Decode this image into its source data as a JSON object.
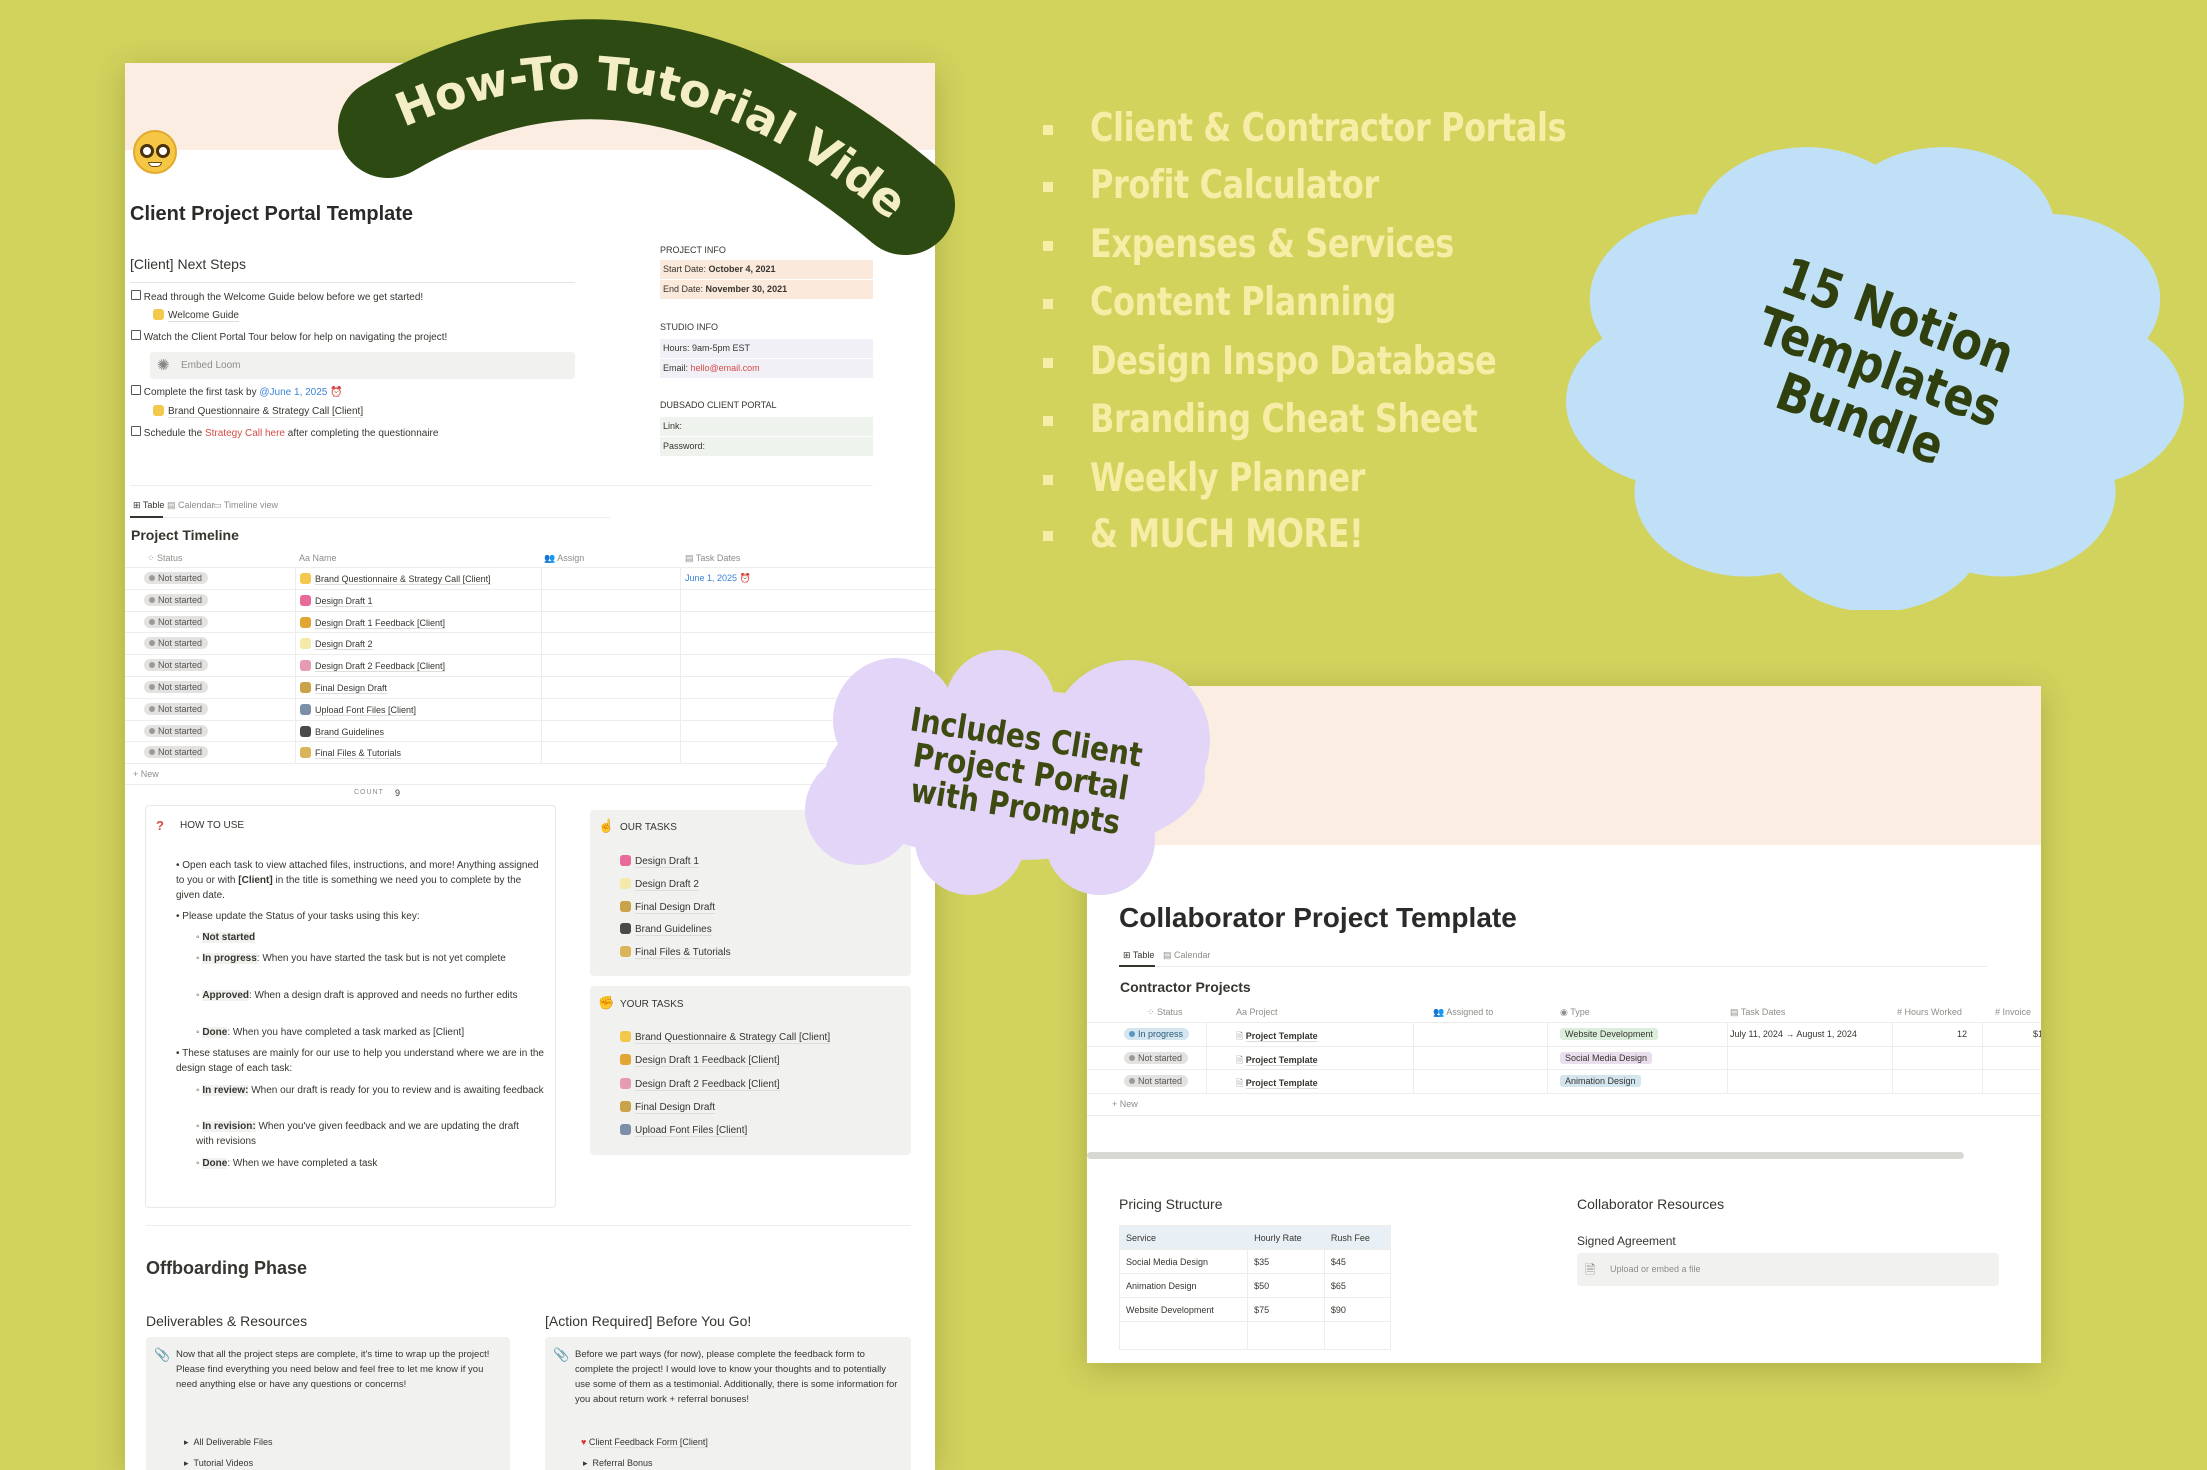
{
  "colors": {
    "background": "#d2d35d",
    "banner": "#2d4a12",
    "feature_text": "#f7eda6",
    "flower": "#bfe0f7",
    "cloud": "#e3d5f7",
    "accent_text": "#3d4a10",
    "peach": "#fbede2"
  },
  "banner": {
    "text": "+ How-To Tutorial Video"
  },
  "features": [
    "Client & Contractor Portals",
    "Profit Calculator",
    "Expenses & Services",
    "Content Planning",
    "Design Inspo Database",
    "Branding Cheat Sheet",
    "Weekly Planner",
    "& MUCH MORE!"
  ],
  "flower": {
    "lines": [
      "15 Notion",
      "Templates",
      "Bundle"
    ]
  },
  "cloud": {
    "lines": [
      "Includes Client",
      "Project Portal",
      "with Prompts"
    ]
  },
  "client_portal": {
    "page_icon": "nerd-face-emoji",
    "title": "Client Project Portal Template",
    "next_steps": {
      "heading": "[Client] Next Steps",
      "item1": "Read through the Welcome Guide below before we get started!",
      "welcome_link": "Welcome Guide",
      "item2": "Watch the Client Portal Tour below for help on navigating the project!",
      "embed": "Embed Loom",
      "item3_prefix": "Complete the first task by ",
      "item3_date": "@June 1, 2025",
      "task_link": "Brand Questionnaire & Strategy Call [Client]",
      "item4_prefix": "Schedule the ",
      "item4_link": "Strategy Call here",
      "item4_suffix": " after completing the questionnaire"
    },
    "project_info": {
      "heading": "PROJECT INFO",
      "start_label": "Start Date: ",
      "start": "October 4, 2021",
      "end_label": "End Date: ",
      "end": "November 30, 2021"
    },
    "studio_info": {
      "heading": "STUDIO INFO",
      "hours": "Hours: 9am-5pm EST",
      "email_label": "Email: ",
      "email": "hello@email.com"
    },
    "dubsado": {
      "heading": "DUBSADO CLIENT PORTAL",
      "link": "Link:",
      "password": "Password:"
    },
    "tabs": [
      "Table",
      "Calendar",
      "Timeline view"
    ],
    "timeline": {
      "title": "Project Timeline",
      "columns": [
        "Status",
        "Name",
        "Assign",
        "Task Dates"
      ],
      "rows": [
        {
          "status": "Not started",
          "name": "Brand Questionnaire & Strategy Call [Client]",
          "date": "June 1, 2025",
          "icon": "#f2c94c"
        },
        {
          "status": "Not started",
          "name": "Design Draft 1",
          "date": "",
          "icon": "#e86a9a"
        },
        {
          "status": "Not started",
          "name": "Design Draft 1 Feedback [Client]",
          "date": "",
          "icon": "#e2a634"
        },
        {
          "status": "Not started",
          "name": "Design Draft 2",
          "date": "",
          "icon": "#f4e9a8"
        },
        {
          "status": "Not started",
          "name": "Design Draft 2 Feedback [Client]",
          "date": "",
          "icon": "#e59bb0"
        },
        {
          "status": "Not started",
          "name": "Final Design Draft",
          "date": "",
          "icon": "#c9a24a"
        },
        {
          "status": "Not started",
          "name": "Upload Font Files [Client]",
          "date": "",
          "icon": "#7b8fa8"
        },
        {
          "status": "Not started",
          "name": "Brand Guidelines",
          "date": "",
          "icon": "#4a4a4a"
        },
        {
          "status": "Not started",
          "name": "Final Files & Tutorials",
          "date": "",
          "icon": "#d9b45a"
        }
      ],
      "new_label": "New",
      "count_label": "COUNT",
      "count": "9"
    },
    "how_to_use": {
      "heading": "HOW TO USE",
      "b1a": "Open each task to view attached files, instructions, and more! Anything assigned to you or with ",
      "b1b": "[Client]",
      "b1c": " in the title is something we need you to complete by the given date.",
      "b2": "Please update the Status of your tasks using this key:",
      "k1": "Not started",
      "k2": "In progress",
      "k2t": ": When you have started the task but is not yet complete",
      "k3": "Approved",
      "k3t": ": When a design draft is approved and needs no further edits",
      "k4": "Done",
      "k4t": ": When you have completed a task marked as [Client]",
      "b3": "These statuses are mainly for our use to help you understand where we are in the design stage of each task:",
      "k5": "In review:",
      "k5t": " When our draft is ready for you to review and is awaiting feedback",
      "k6": "In revision:",
      "k6t": " When you've given feedback and we are updating the draft with revisions",
      "k7": "Done",
      "k7t": ": When we have completed a task"
    },
    "our_tasks": {
      "heading": "OUR TASKS",
      "items": [
        "Design Draft 1",
        "Design Draft 2",
        "Final Design Draft",
        "Brand Guidelines",
        "Final Files & Tutorials"
      ]
    },
    "your_tasks": {
      "heading": "YOUR TASKS",
      "items": [
        "Brand Questionnaire & Strategy Call [Client]",
        "Design Draft 1 Feedback [Client]",
        "Design Draft 2 Feedback [Client]",
        "Final Design Draft",
        "Upload Font Files [Client]"
      ]
    },
    "offboarding": {
      "heading": "Offboarding Phase",
      "deliverables": {
        "heading": "Deliverables & Resources",
        "text": "Now that all the project steps are complete, it's time to wrap up the project! Please find everything you need below and feel free to let me know if you need anything else or have any questions or concerns!",
        "toggles": [
          "All Deliverable Files",
          "Tutorial Videos"
        ]
      },
      "action": {
        "heading": "[Action Required] Before You Go!",
        "text": "Before we part ways (for now), please complete the feedback form to complete the project! I would love to know your thoughts and to potentially use some of them as a testimonial. Additionally, there is some information for you about return work + referral bonuses!",
        "link": "Client Feedback Form [Client]",
        "toggle": "Referral Bonus"
      }
    }
  },
  "collaborator": {
    "title": "Collaborator Project Template",
    "tabs": [
      "Table",
      "Calendar"
    ],
    "table": {
      "title": "Contractor Projects",
      "columns": [
        "Status",
        "Project",
        "Assigned to",
        "Type",
        "Task Dates",
        "Hours Worked",
        "Invoice"
      ],
      "rows": [
        {
          "status": "In progress",
          "project": "Project Template",
          "type": "Website Development",
          "type_color": "#dbeddb",
          "dates": "July 11, 2024 → August 1, 2024",
          "hours": "12",
          "invoice": "$1"
        },
        {
          "status": "Not started",
          "project": "Project Template",
          "type": "Social Media Design",
          "type_color": "#e8deee",
          "dates": "",
          "hours": "",
          "invoice": ""
        },
        {
          "status": "Not started",
          "project": "Project Template",
          "type": "Animation Design",
          "type_color": "#d3e5ef",
          "dates": "",
          "hours": "",
          "invoice": ""
        }
      ],
      "new_label": "New"
    },
    "pricing": {
      "heading": "Pricing Structure",
      "columns": [
        "Service",
        "Hourly Rate",
        "Rush Fee"
      ],
      "rows": [
        [
          "Social Media Design",
          "$35",
          "$45"
        ],
        [
          "Animation Design",
          "$50",
          "$65"
        ],
        [
          "Website Development",
          "$75",
          "$90"
        ],
        [
          "",
          "",
          ""
        ]
      ]
    },
    "resources": {
      "heading": "Collaborator Resources",
      "signed": "Signed Agreement",
      "upload": "Upload or embed a file"
    }
  }
}
